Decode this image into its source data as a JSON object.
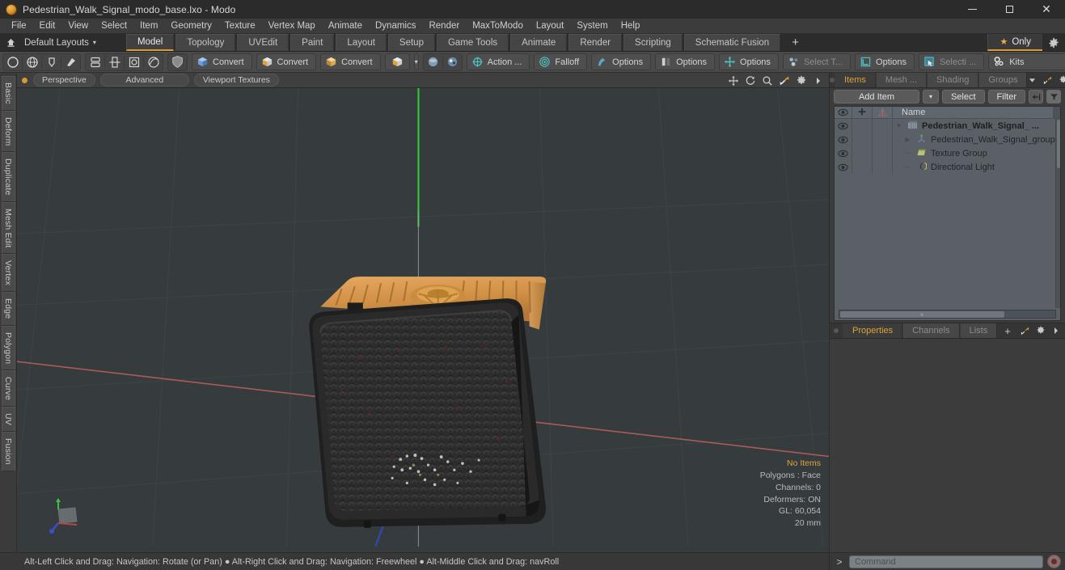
{
  "window": {
    "title": "Pedestrian_Walk_Signal_modo_base.lxo - Modo",
    "logo_icon": "modo-logo-icon",
    "minimize_icon": "minimize-icon",
    "maximize_icon": "maximize-icon",
    "close_icon": "close-icon"
  },
  "menubar": {
    "items": [
      {
        "label": "File"
      },
      {
        "label": "Edit"
      },
      {
        "label": "View"
      },
      {
        "label": "Select"
      },
      {
        "label": "Item"
      },
      {
        "label": "Geometry"
      },
      {
        "label": "Texture"
      },
      {
        "label": "Vertex Map"
      },
      {
        "label": "Animate"
      },
      {
        "label": "Dynamics"
      },
      {
        "label": "Render"
      },
      {
        "label": "MaxToModo"
      },
      {
        "label": "Layout"
      },
      {
        "label": "System"
      },
      {
        "label": "Help"
      }
    ]
  },
  "layoutbar": {
    "home_icon": "home-layout-icon",
    "layout_select": "Default Layouts",
    "caret": "▾",
    "tabs": [
      {
        "label": "Model",
        "active": true
      },
      {
        "label": "Topology",
        "active": false
      },
      {
        "label": "UVEdit",
        "active": false
      },
      {
        "label": "Paint",
        "active": false
      },
      {
        "label": "Layout",
        "active": false
      },
      {
        "label": "Setup",
        "active": false
      },
      {
        "label": "Game Tools",
        "active": false
      },
      {
        "label": "Animate",
        "active": false
      },
      {
        "label": "Render",
        "active": false
      },
      {
        "label": "Scripting",
        "active": false
      },
      {
        "label": "Schematic Fusion",
        "active": false
      }
    ],
    "add_tab_label": "+",
    "only_label": "Only",
    "only_star": "★",
    "gear_icon": "gear-icon"
  },
  "toolbar": {
    "group1": [
      {
        "icon": "circle-primitive-icon"
      },
      {
        "icon": "sphere-primitive-icon"
      },
      {
        "icon": "cone-primitive-icon"
      },
      {
        "icon": "pen-tool-icon"
      }
    ],
    "group2": [
      {
        "icon": "array-duplicate-icon"
      },
      {
        "icon": "mirror-icon"
      },
      {
        "icon": "bevel-icon"
      },
      {
        "icon": "smooth-icon"
      }
    ],
    "group3": [
      {
        "icon": "shield-icon"
      }
    ],
    "convert_buttons": [
      {
        "label": "Convert",
        "icon": "convert-blue-cube-icon"
      },
      {
        "label": "Convert",
        "icon": "convert-gray-cube-icon"
      },
      {
        "label": "Convert",
        "icon": "convert-yellow-cube-icon"
      }
    ],
    "cube_drop": {
      "icon": "cube-icon",
      "caret": "▾"
    },
    "small_icons": [
      {
        "icon": "uv-sphere-icon"
      },
      {
        "icon": "paint-sphere-icon"
      }
    ],
    "pills": [
      {
        "label": "Action  ...",
        "icon": "action-center-icon",
        "dim": false
      },
      {
        "label": "Falloff",
        "icon": "falloff-icon",
        "dim": false
      },
      {
        "label": "Options",
        "icon": "snap-options-icon",
        "dim": false
      },
      {
        "label": "Options",
        "icon": "symmetry-options-icon",
        "dim": false
      },
      {
        "label": "Options",
        "icon": "axis-options-icon",
        "dim": false
      },
      {
        "label": "Select T...",
        "icon": "select-through-icon",
        "dim": true
      },
      {
        "label": "Options",
        "icon": "workplane-options-icon",
        "dim": false
      },
      {
        "label": "Selecti ...",
        "icon": "selection-set-icon",
        "dim": true
      },
      {
        "label": "Kits",
        "icon": "kits-icon",
        "dim": false
      }
    ],
    "right_icons": [
      {
        "icon": "preset-browser-icon"
      },
      {
        "icon": "unreal-engine-icon"
      }
    ]
  },
  "left_tabs": [
    {
      "label": "Basic"
    },
    {
      "label": "Deform"
    },
    {
      "label": "Duplicate"
    },
    {
      "label": "Mesh Edit"
    },
    {
      "label": "Vertex"
    },
    {
      "label": "Edge"
    },
    {
      "label": "Polygon"
    },
    {
      "label": "Curve"
    },
    {
      "label": "UV"
    },
    {
      "label": "Fusion"
    }
  ],
  "viewport": {
    "dot_icon": "viewport-active-dot-icon",
    "pills": [
      {
        "label": "Perspective"
      },
      {
        "label": "Advanced"
      },
      {
        "label": "Viewport Textures"
      }
    ],
    "right_icons": [
      {
        "icon": "pan-icon"
      },
      {
        "icon": "rotate-icon"
      },
      {
        "icon": "zoom-magnifier-icon"
      },
      {
        "icon": "fit-view-icon"
      },
      {
        "icon": "viewport-gear-icon"
      },
      {
        "icon": "chevron-right-icon"
      }
    ],
    "stats": {
      "selection": "No Items",
      "polygons": "Polygons : Face",
      "channels": "Channels: 0",
      "deformers": "Deformers: ON",
      "gl": "GL: 60,054",
      "scale": "20 mm"
    },
    "axis_gizmo": "axis-gizmo-icon",
    "colors": {
      "background": "#363c3e",
      "grid": "#3f4749",
      "x_axis": "#b05a5a",
      "y_axis": "#4caf50",
      "z_axis": "#3a56c8",
      "model_body": "#2d2d2d",
      "model_top": "#d89a55",
      "accent": "#e09a2b"
    }
  },
  "rightdock": {
    "tabs": [
      {
        "label": "Items",
        "active": true
      },
      {
        "label": "Mesh ...",
        "active": false
      },
      {
        "label": "Shading",
        "active": false
      },
      {
        "label": "Groups",
        "active": false
      }
    ],
    "tabrow_icons": [
      {
        "icon": "chevron-down-icon"
      },
      {
        "icon": "expand-panel-icon"
      },
      {
        "icon": "gear-icon"
      },
      {
        "icon": "chevron-right-icon"
      }
    ],
    "toolbar": {
      "add_item": "Add Item",
      "add_item_caret": "▾",
      "select": "Select",
      "filter": "Filter",
      "collapse_icon": "collapse-arrow-icon",
      "funnel_icon": "funnel-icon"
    },
    "list": {
      "columns": [
        {
          "icon": "eye-icon"
        },
        {
          "icon": "lock-plus-icon"
        },
        {
          "icon": "render-flag-icon"
        },
        {
          "label": "Name"
        }
      ],
      "rows": [
        {
          "label": "Pedestrian_Walk_Signal_ ...",
          "icon": "mesh-item-icon",
          "indent": 0,
          "triangle": "▼",
          "bold": true,
          "eye": "eye-icon"
        },
        {
          "label": "Pedestrian_Walk_Signal_group",
          "icon": "group-locator-icon",
          "indent": 1,
          "triangle": "▶",
          "bold": false,
          "eye": "eye-icon"
        },
        {
          "label": "Texture Group",
          "icon": "texture-group-icon",
          "indent": 1,
          "triangle": "",
          "bold": false,
          "eye": "eye-icon"
        },
        {
          "label": "Directional Light",
          "icon": "directional-light-icon",
          "indent": 1,
          "triangle": "",
          "bold": false,
          "eye": "eye-icon"
        }
      ]
    },
    "props_tabs": [
      {
        "label": "Properties",
        "active": true
      },
      {
        "label": "Channels",
        "active": false
      },
      {
        "label": "Lists",
        "active": false
      },
      {
        "label": "+",
        "active": false
      }
    ],
    "props_icons": [
      {
        "icon": "expand-panel-icon"
      },
      {
        "icon": "gear-icon"
      },
      {
        "icon": "chevron-right-icon"
      }
    ]
  },
  "statusbar": {
    "hint": "Alt-Left Click and Drag: Navigation: Rotate (or Pan) ● Alt-Right Click and Drag: Navigation: Freewheel ● Alt-Middle Click and Drag: navRoll",
    "command_caret": ">",
    "command_placeholder": "Command",
    "record_icon": "record-macro-icon"
  }
}
